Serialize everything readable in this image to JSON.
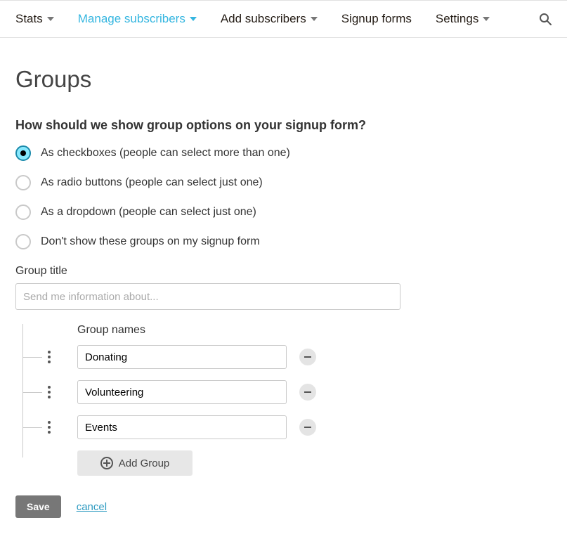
{
  "nav": {
    "items": [
      {
        "label": "Stats",
        "has_caret": true,
        "active": false
      },
      {
        "label": "Manage subscribers",
        "has_caret": true,
        "active": true
      },
      {
        "label": "Add subscribers",
        "has_caret": true,
        "active": false
      },
      {
        "label": "Signup forms",
        "has_caret": false,
        "active": false
      },
      {
        "label": "Settings",
        "has_caret": true,
        "active": false
      }
    ]
  },
  "page": {
    "title": "Groups",
    "question": "How should we show group options on your signup form?",
    "options": [
      {
        "label": "As checkboxes (people can select more than one)",
        "selected": true
      },
      {
        "label": "As radio buttons (people can select just one)",
        "selected": false
      },
      {
        "label": "As a dropdown (people can select just one)",
        "selected": false
      },
      {
        "label": "Don't show these groups on my signup form",
        "selected": false
      }
    ],
    "group_title_label": "Group title",
    "group_title_placeholder": "Send me information about...",
    "group_title_value": "",
    "group_names_label": "Group names",
    "group_names": [
      {
        "value": "Donating"
      },
      {
        "value": "Volunteering"
      },
      {
        "value": "Events"
      }
    ],
    "add_group_label": "Add Group",
    "save_label": "Save",
    "cancel_label": "cancel"
  }
}
